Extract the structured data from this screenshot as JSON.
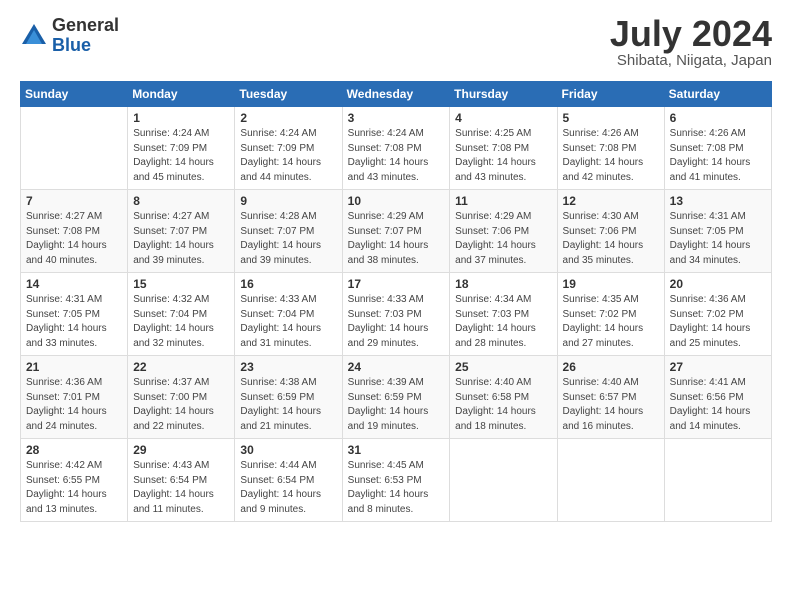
{
  "logo": {
    "general": "General",
    "blue": "Blue"
  },
  "title": "July 2024",
  "location": "Shibata, Niigata, Japan",
  "weekdays": [
    "Sunday",
    "Monday",
    "Tuesday",
    "Wednesday",
    "Thursday",
    "Friday",
    "Saturday"
  ],
  "weeks": [
    [
      {
        "day": "",
        "info": ""
      },
      {
        "day": "1",
        "info": "Sunrise: 4:24 AM\nSunset: 7:09 PM\nDaylight: 14 hours\nand 45 minutes."
      },
      {
        "day": "2",
        "info": "Sunrise: 4:24 AM\nSunset: 7:09 PM\nDaylight: 14 hours\nand 44 minutes."
      },
      {
        "day": "3",
        "info": "Sunrise: 4:24 AM\nSunset: 7:08 PM\nDaylight: 14 hours\nand 43 minutes."
      },
      {
        "day": "4",
        "info": "Sunrise: 4:25 AM\nSunset: 7:08 PM\nDaylight: 14 hours\nand 43 minutes."
      },
      {
        "day": "5",
        "info": "Sunrise: 4:26 AM\nSunset: 7:08 PM\nDaylight: 14 hours\nand 42 minutes."
      },
      {
        "day": "6",
        "info": "Sunrise: 4:26 AM\nSunset: 7:08 PM\nDaylight: 14 hours\nand 41 minutes."
      }
    ],
    [
      {
        "day": "7",
        "info": "Sunrise: 4:27 AM\nSunset: 7:08 PM\nDaylight: 14 hours\nand 40 minutes."
      },
      {
        "day": "8",
        "info": "Sunrise: 4:27 AM\nSunset: 7:07 PM\nDaylight: 14 hours\nand 39 minutes."
      },
      {
        "day": "9",
        "info": "Sunrise: 4:28 AM\nSunset: 7:07 PM\nDaylight: 14 hours\nand 39 minutes."
      },
      {
        "day": "10",
        "info": "Sunrise: 4:29 AM\nSunset: 7:07 PM\nDaylight: 14 hours\nand 38 minutes."
      },
      {
        "day": "11",
        "info": "Sunrise: 4:29 AM\nSunset: 7:06 PM\nDaylight: 14 hours\nand 37 minutes."
      },
      {
        "day": "12",
        "info": "Sunrise: 4:30 AM\nSunset: 7:06 PM\nDaylight: 14 hours\nand 35 minutes."
      },
      {
        "day": "13",
        "info": "Sunrise: 4:31 AM\nSunset: 7:05 PM\nDaylight: 14 hours\nand 34 minutes."
      }
    ],
    [
      {
        "day": "14",
        "info": "Sunrise: 4:31 AM\nSunset: 7:05 PM\nDaylight: 14 hours\nand 33 minutes."
      },
      {
        "day": "15",
        "info": "Sunrise: 4:32 AM\nSunset: 7:04 PM\nDaylight: 14 hours\nand 32 minutes."
      },
      {
        "day": "16",
        "info": "Sunrise: 4:33 AM\nSunset: 7:04 PM\nDaylight: 14 hours\nand 31 minutes."
      },
      {
        "day": "17",
        "info": "Sunrise: 4:33 AM\nSunset: 7:03 PM\nDaylight: 14 hours\nand 29 minutes."
      },
      {
        "day": "18",
        "info": "Sunrise: 4:34 AM\nSunset: 7:03 PM\nDaylight: 14 hours\nand 28 minutes."
      },
      {
        "day": "19",
        "info": "Sunrise: 4:35 AM\nSunset: 7:02 PM\nDaylight: 14 hours\nand 27 minutes."
      },
      {
        "day": "20",
        "info": "Sunrise: 4:36 AM\nSunset: 7:02 PM\nDaylight: 14 hours\nand 25 minutes."
      }
    ],
    [
      {
        "day": "21",
        "info": "Sunrise: 4:36 AM\nSunset: 7:01 PM\nDaylight: 14 hours\nand 24 minutes."
      },
      {
        "day": "22",
        "info": "Sunrise: 4:37 AM\nSunset: 7:00 PM\nDaylight: 14 hours\nand 22 minutes."
      },
      {
        "day": "23",
        "info": "Sunrise: 4:38 AM\nSunset: 6:59 PM\nDaylight: 14 hours\nand 21 minutes."
      },
      {
        "day": "24",
        "info": "Sunrise: 4:39 AM\nSunset: 6:59 PM\nDaylight: 14 hours\nand 19 minutes."
      },
      {
        "day": "25",
        "info": "Sunrise: 4:40 AM\nSunset: 6:58 PM\nDaylight: 14 hours\nand 18 minutes."
      },
      {
        "day": "26",
        "info": "Sunrise: 4:40 AM\nSunset: 6:57 PM\nDaylight: 14 hours\nand 16 minutes."
      },
      {
        "day": "27",
        "info": "Sunrise: 4:41 AM\nSunset: 6:56 PM\nDaylight: 14 hours\nand 14 minutes."
      }
    ],
    [
      {
        "day": "28",
        "info": "Sunrise: 4:42 AM\nSunset: 6:55 PM\nDaylight: 14 hours\nand 13 minutes."
      },
      {
        "day": "29",
        "info": "Sunrise: 4:43 AM\nSunset: 6:54 PM\nDaylight: 14 hours\nand 11 minutes."
      },
      {
        "day": "30",
        "info": "Sunrise: 4:44 AM\nSunset: 6:54 PM\nDaylight: 14 hours\nand 9 minutes."
      },
      {
        "day": "31",
        "info": "Sunrise: 4:45 AM\nSunset: 6:53 PM\nDaylight: 14 hours\nand 8 minutes."
      },
      {
        "day": "",
        "info": ""
      },
      {
        "day": "",
        "info": ""
      },
      {
        "day": "",
        "info": ""
      }
    ]
  ]
}
